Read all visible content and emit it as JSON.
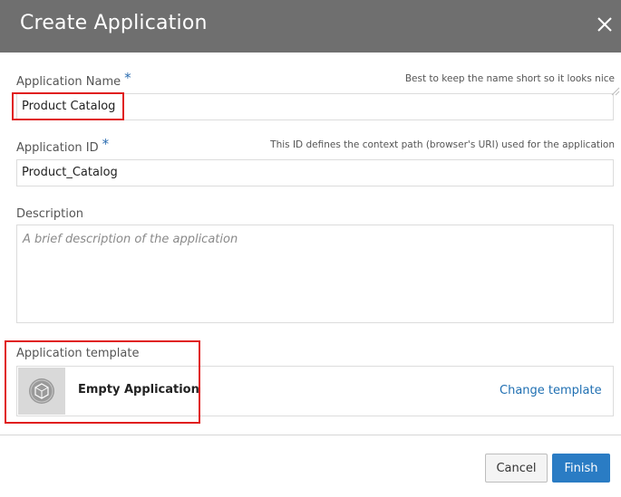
{
  "dialog": {
    "title": "Create Application"
  },
  "form": {
    "app_name": {
      "label": "Application Name",
      "required_marker": "*",
      "hint": "Best to keep the name short so it looks nice",
      "value": "Product Catalog"
    },
    "app_id": {
      "label": "Application ID",
      "required_marker": "*",
      "hint": "This ID defines the context path (browser's URI) used for the application",
      "value": "Product_Catalog"
    },
    "description": {
      "label": "Description",
      "placeholder": "A brief description of the application"
    },
    "template": {
      "label": "Application template",
      "name": "Empty Application",
      "change_label": "Change template"
    }
  },
  "footer": {
    "cancel_label": "Cancel",
    "finish_label": "Finish"
  },
  "colors": {
    "header_bg": "#6f6f6f",
    "accent": "#2a7cc4",
    "highlight": "#e01e1e"
  }
}
